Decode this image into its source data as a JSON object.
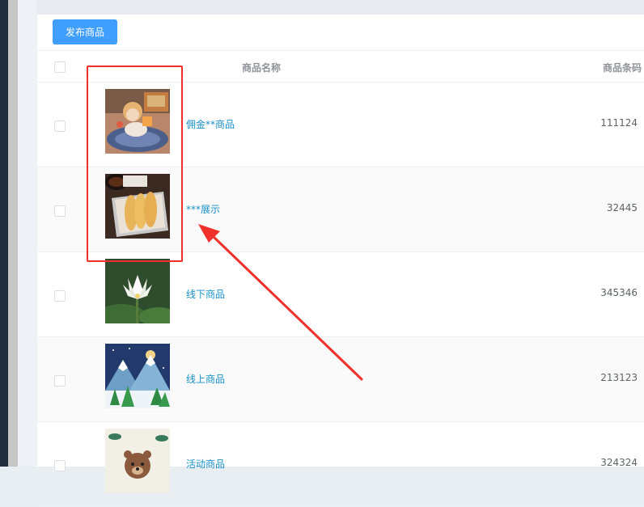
{
  "toolbar": {
    "publish_label": "发布商品"
  },
  "table": {
    "columns": {
      "name": "商品名称",
      "barcode": "商品条码"
    },
    "rows": [
      {
        "name": "佣金**商品",
        "barcode": "111124",
        "image": "doll-with-cake-photo"
      },
      {
        "name": "***展示",
        "barcode": "32445",
        "image": "bread-basket-photo"
      },
      {
        "name": "线下商品",
        "barcode": "345346",
        "image": "lotus-flower-photo"
      },
      {
        "name": "线上商品",
        "barcode": "213123",
        "image": "snowy-mountain-illustration"
      },
      {
        "name": "活动商品",
        "barcode": "324324",
        "image": "bear-illustration"
      }
    ]
  },
  "colors": {
    "accent": "#409eff",
    "link": "#1890c7",
    "annotation": "#f0302a"
  }
}
